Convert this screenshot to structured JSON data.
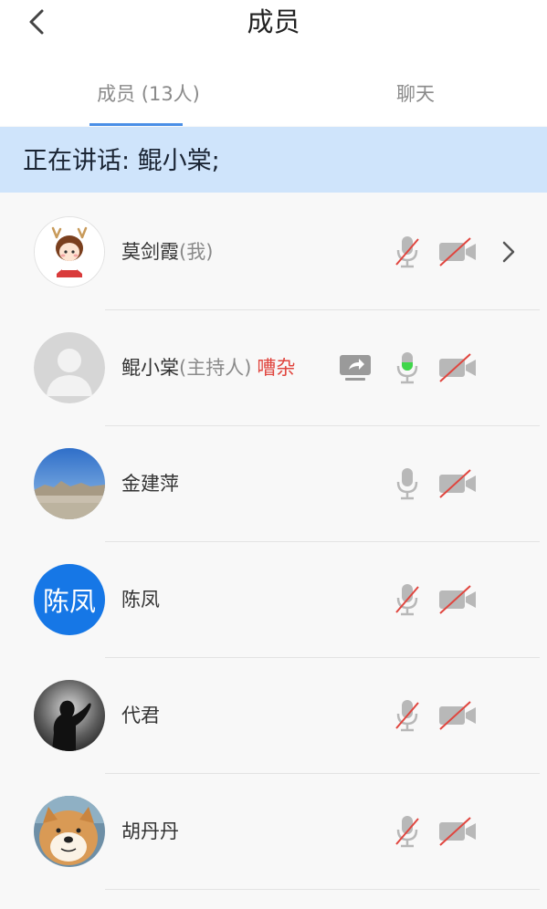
{
  "header": {
    "title": "成员"
  },
  "tabs": {
    "members": "成员 (13人)",
    "chat": "聊天"
  },
  "speaking": {
    "text": "正在讲话: 鲲小棠;"
  },
  "members": [
    {
      "name": "莫剑霞",
      "role": "(我)",
      "tag": "",
      "avatar": "cartoon-girl",
      "mic": "muted",
      "camera": "off",
      "share": false,
      "chevron": true
    },
    {
      "name": "鲲小棠",
      "role": "(主持人)",
      "tag": "嘈杂",
      "avatar": "default-person",
      "mic": "speaking",
      "camera": "off",
      "share": true,
      "chevron": false
    },
    {
      "name": "金建萍",
      "role": "",
      "tag": "",
      "avatar": "landscape-photo",
      "mic": "on",
      "camera": "off",
      "share": false,
      "chevron": false
    },
    {
      "name": "陈凤",
      "role": "",
      "tag": "",
      "avatar": "initials",
      "avatar_text": "陈凤",
      "mic": "muted",
      "camera": "off",
      "share": false,
      "chevron": false
    },
    {
      "name": "代君",
      "role": "",
      "tag": "",
      "avatar": "silhouette-photo",
      "mic": "muted",
      "camera": "off",
      "share": false,
      "chevron": false
    },
    {
      "name": "胡丹丹",
      "role": "",
      "tag": "",
      "avatar": "dog-photo",
      "mic": "muted",
      "camera": "off",
      "share": false,
      "chevron": false
    }
  ],
  "colors": {
    "accent": "#4a8fe6",
    "speaking_bar": "#cfe4fb",
    "mic_active": "#3fd64a",
    "muted_slash": "#e0453e",
    "noisy": "#e0453e",
    "initials_bg": "#1677e6"
  }
}
